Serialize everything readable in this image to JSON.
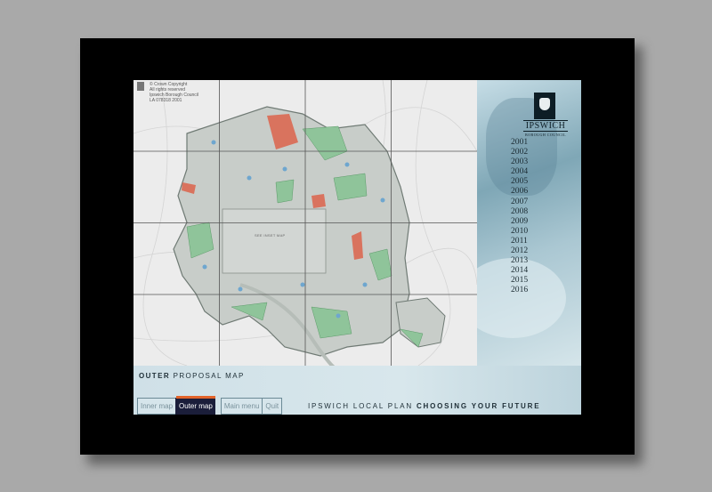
{
  "map": {
    "copyright_lines": [
      "© Crown Copyright",
      "All rights reserved",
      "Ipswich Borough Council",
      "LA 078318   2001"
    ],
    "inset_label": "SEE INSET MAP"
  },
  "logo": {
    "name": "IPSWICH",
    "subtitle": "BOROUGH COUNCIL"
  },
  "years": [
    "2001",
    "2002",
    "2003",
    "2004",
    "2005",
    "2006",
    "2007",
    "2008",
    "2009",
    "2010",
    "2011",
    "2012",
    "2013",
    "2014",
    "2015",
    "2016"
  ],
  "page_title": {
    "bold": "OUTER",
    "rest": "PROPOSAL MAP"
  },
  "nav": {
    "inner_map": "Inner map",
    "outer_map": "Outer map",
    "main_menu": "Main menu",
    "quit": "Quit"
  },
  "tagline": {
    "plain": "IPSWICH LOCAL PLAN",
    "bold": "CHOOSING YOUR FUTURE"
  },
  "colors": {
    "frame": "#000000",
    "active_tab": "#1b1e3a",
    "active_tab_accent": "#e2632a"
  }
}
